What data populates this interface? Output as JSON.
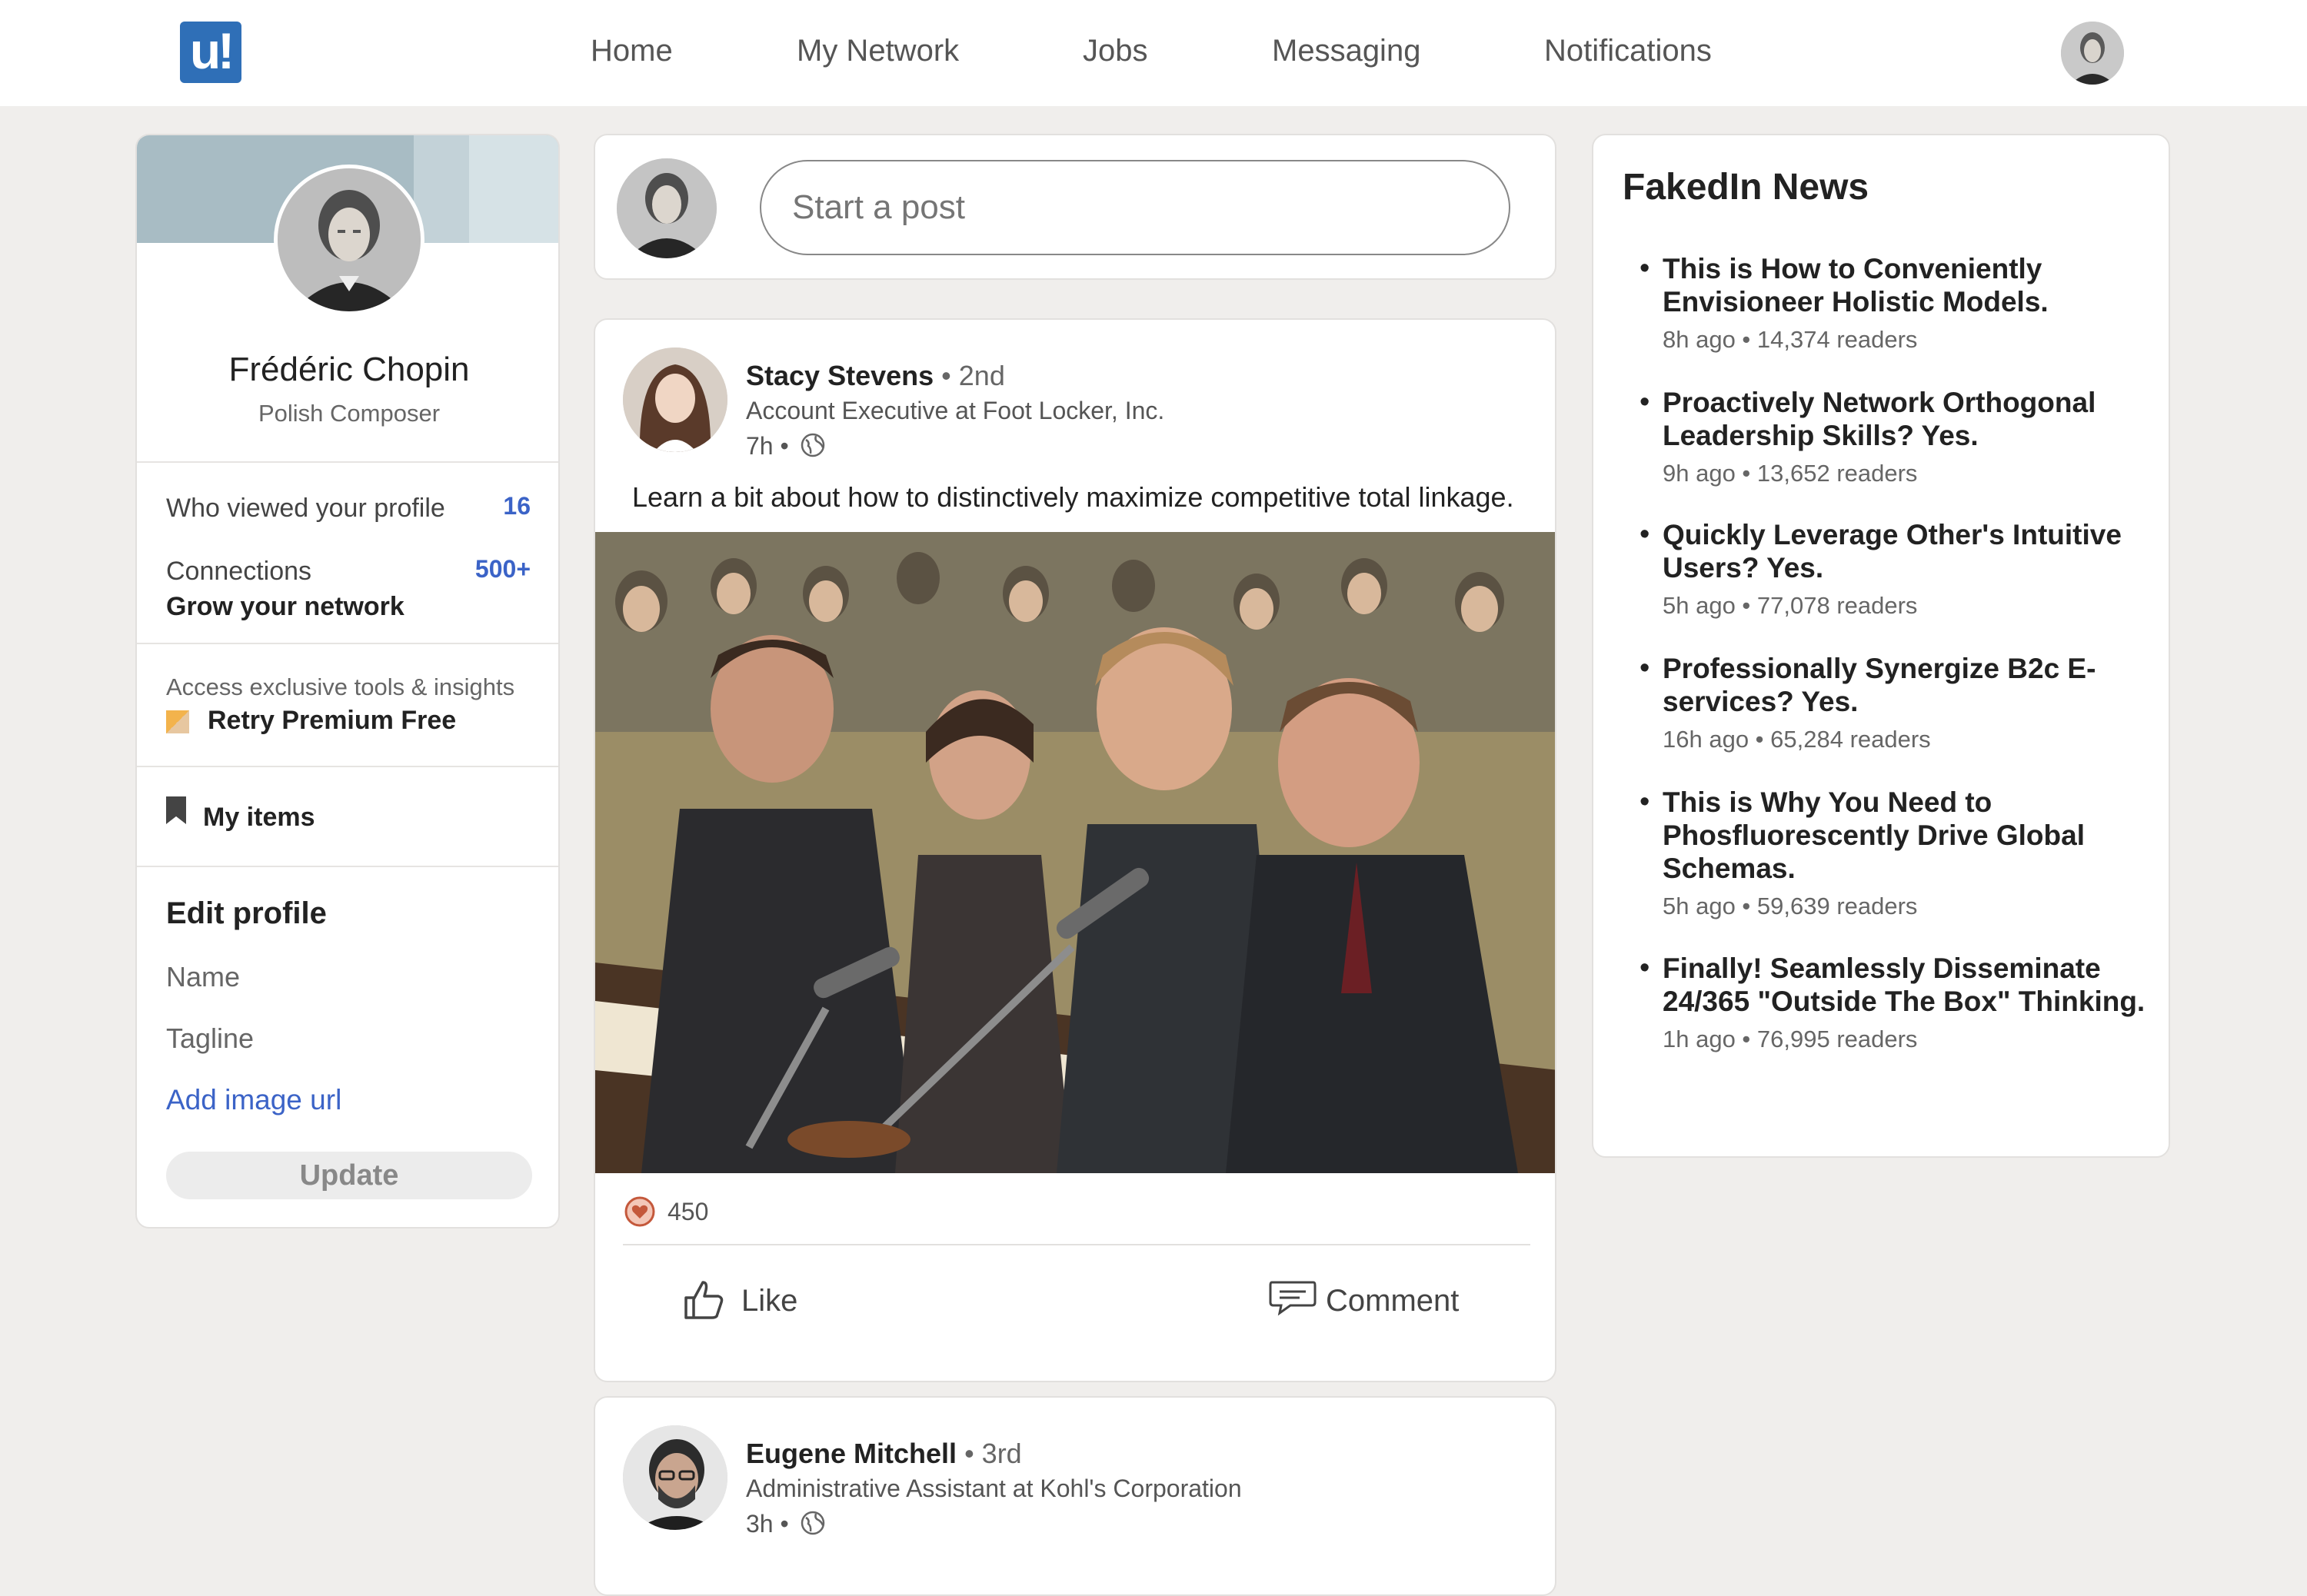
{
  "nav": {
    "logo": "u!",
    "links": [
      "Home",
      "My Network",
      "Jobs",
      "Messaging",
      "Notifications"
    ]
  },
  "profile": {
    "name": "Frédéric Chopin",
    "tagline": "Polish Composer",
    "viewed_label": "Who viewed your profile",
    "viewed_count": "16",
    "connections_label": "Connections",
    "connections_count": "500+",
    "grow_network": "Grow your network",
    "premium_prompt": "Access exclusive tools & insights",
    "premium_cta": "Retry Premium Free",
    "my_items": "My items",
    "edit_title": "Edit profile",
    "field_name": "Name",
    "field_tagline": "Tagline",
    "add_image": "Add image url",
    "update": "Update"
  },
  "compose": {
    "placeholder": "Start a post"
  },
  "posts": [
    {
      "author": "Stacy Stevens",
      "degree": "• 2nd",
      "title": "Account Executive at Foot Locker, Inc.",
      "time": "7h •",
      "text": "Learn a bit about how to distinctively maximize competitive total linkage.",
      "reactions": "450",
      "like": "Like",
      "comment": "Comment"
    },
    {
      "author": "Eugene Mitchell",
      "degree": "• 3rd",
      "title": "Administrative Assistant at Kohl's Corporation",
      "time": "3h •"
    }
  ],
  "news": {
    "title": "FakedIn News",
    "items": [
      {
        "headline": "This is How to Conveniently Envisioneer Holistic Models.",
        "meta": "8h ago • 14,374 readers"
      },
      {
        "headline": "Proactively Network Orthogonal Leadership Skills? Yes.",
        "meta": "9h ago • 13,652 readers"
      },
      {
        "headline": "Quickly Leverage Other's Intuitive Users? Yes.",
        "meta": "5h ago • 77,078 readers"
      },
      {
        "headline": "Professionally Synergize B2c E-services? Yes.",
        "meta": "16h ago • 65,284 readers"
      },
      {
        "headline": "This is Why You Need to Phosfluorescently Drive Global Schemas.",
        "meta": "5h ago • 59,639 readers"
      },
      {
        "headline": "Finally! Seamlessly Disseminate 24/365 \"Outside The Box\" Thinking.",
        "meta": "1h ago • 76,995 readers"
      }
    ]
  },
  "colors": {
    "accent": "#3b63c7",
    "logo": "#2f6fb7",
    "background": "#f0eeec"
  }
}
